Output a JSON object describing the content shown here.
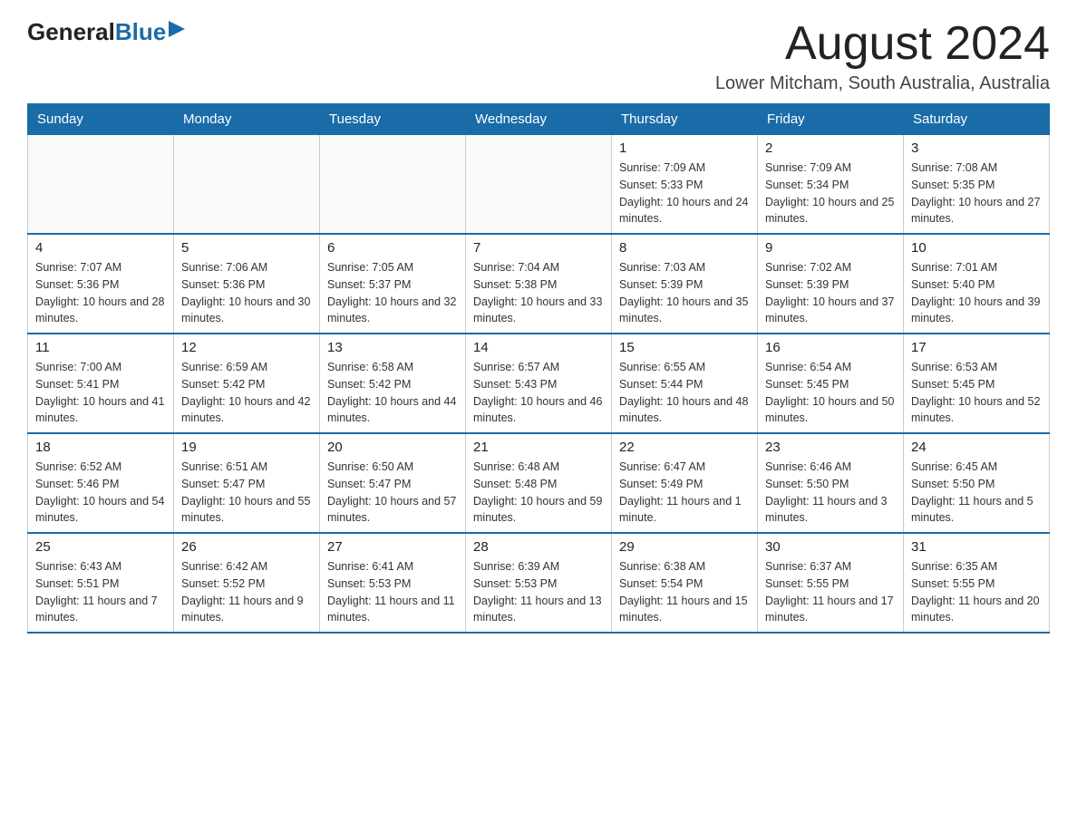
{
  "logo": {
    "general": "General",
    "blue": "Blue",
    "arrow": "▶"
  },
  "title": "August 2024",
  "location": "Lower Mitcham, South Australia, Australia",
  "days_of_week": [
    "Sunday",
    "Monday",
    "Tuesday",
    "Wednesday",
    "Thursday",
    "Friday",
    "Saturday"
  ],
  "weeks": [
    [
      {
        "day": "",
        "info": ""
      },
      {
        "day": "",
        "info": ""
      },
      {
        "day": "",
        "info": ""
      },
      {
        "day": "",
        "info": ""
      },
      {
        "day": "1",
        "info": "Sunrise: 7:09 AM\nSunset: 5:33 PM\nDaylight: 10 hours and 24 minutes."
      },
      {
        "day": "2",
        "info": "Sunrise: 7:09 AM\nSunset: 5:34 PM\nDaylight: 10 hours and 25 minutes."
      },
      {
        "day": "3",
        "info": "Sunrise: 7:08 AM\nSunset: 5:35 PM\nDaylight: 10 hours and 27 minutes."
      }
    ],
    [
      {
        "day": "4",
        "info": "Sunrise: 7:07 AM\nSunset: 5:36 PM\nDaylight: 10 hours and 28 minutes."
      },
      {
        "day": "5",
        "info": "Sunrise: 7:06 AM\nSunset: 5:36 PM\nDaylight: 10 hours and 30 minutes."
      },
      {
        "day": "6",
        "info": "Sunrise: 7:05 AM\nSunset: 5:37 PM\nDaylight: 10 hours and 32 minutes."
      },
      {
        "day": "7",
        "info": "Sunrise: 7:04 AM\nSunset: 5:38 PM\nDaylight: 10 hours and 33 minutes."
      },
      {
        "day": "8",
        "info": "Sunrise: 7:03 AM\nSunset: 5:39 PM\nDaylight: 10 hours and 35 minutes."
      },
      {
        "day": "9",
        "info": "Sunrise: 7:02 AM\nSunset: 5:39 PM\nDaylight: 10 hours and 37 minutes."
      },
      {
        "day": "10",
        "info": "Sunrise: 7:01 AM\nSunset: 5:40 PM\nDaylight: 10 hours and 39 minutes."
      }
    ],
    [
      {
        "day": "11",
        "info": "Sunrise: 7:00 AM\nSunset: 5:41 PM\nDaylight: 10 hours and 41 minutes."
      },
      {
        "day": "12",
        "info": "Sunrise: 6:59 AM\nSunset: 5:42 PM\nDaylight: 10 hours and 42 minutes."
      },
      {
        "day": "13",
        "info": "Sunrise: 6:58 AM\nSunset: 5:42 PM\nDaylight: 10 hours and 44 minutes."
      },
      {
        "day": "14",
        "info": "Sunrise: 6:57 AM\nSunset: 5:43 PM\nDaylight: 10 hours and 46 minutes."
      },
      {
        "day": "15",
        "info": "Sunrise: 6:55 AM\nSunset: 5:44 PM\nDaylight: 10 hours and 48 minutes."
      },
      {
        "day": "16",
        "info": "Sunrise: 6:54 AM\nSunset: 5:45 PM\nDaylight: 10 hours and 50 minutes."
      },
      {
        "day": "17",
        "info": "Sunrise: 6:53 AM\nSunset: 5:45 PM\nDaylight: 10 hours and 52 minutes."
      }
    ],
    [
      {
        "day": "18",
        "info": "Sunrise: 6:52 AM\nSunset: 5:46 PM\nDaylight: 10 hours and 54 minutes."
      },
      {
        "day": "19",
        "info": "Sunrise: 6:51 AM\nSunset: 5:47 PM\nDaylight: 10 hours and 55 minutes."
      },
      {
        "day": "20",
        "info": "Sunrise: 6:50 AM\nSunset: 5:47 PM\nDaylight: 10 hours and 57 minutes."
      },
      {
        "day": "21",
        "info": "Sunrise: 6:48 AM\nSunset: 5:48 PM\nDaylight: 10 hours and 59 minutes."
      },
      {
        "day": "22",
        "info": "Sunrise: 6:47 AM\nSunset: 5:49 PM\nDaylight: 11 hours and 1 minute."
      },
      {
        "day": "23",
        "info": "Sunrise: 6:46 AM\nSunset: 5:50 PM\nDaylight: 11 hours and 3 minutes."
      },
      {
        "day": "24",
        "info": "Sunrise: 6:45 AM\nSunset: 5:50 PM\nDaylight: 11 hours and 5 minutes."
      }
    ],
    [
      {
        "day": "25",
        "info": "Sunrise: 6:43 AM\nSunset: 5:51 PM\nDaylight: 11 hours and 7 minutes."
      },
      {
        "day": "26",
        "info": "Sunrise: 6:42 AM\nSunset: 5:52 PM\nDaylight: 11 hours and 9 minutes."
      },
      {
        "day": "27",
        "info": "Sunrise: 6:41 AM\nSunset: 5:53 PM\nDaylight: 11 hours and 11 minutes."
      },
      {
        "day": "28",
        "info": "Sunrise: 6:39 AM\nSunset: 5:53 PM\nDaylight: 11 hours and 13 minutes."
      },
      {
        "day": "29",
        "info": "Sunrise: 6:38 AM\nSunset: 5:54 PM\nDaylight: 11 hours and 15 minutes."
      },
      {
        "day": "30",
        "info": "Sunrise: 6:37 AM\nSunset: 5:55 PM\nDaylight: 11 hours and 17 minutes."
      },
      {
        "day": "31",
        "info": "Sunrise: 6:35 AM\nSunset: 5:55 PM\nDaylight: 11 hours and 20 minutes."
      }
    ]
  ]
}
